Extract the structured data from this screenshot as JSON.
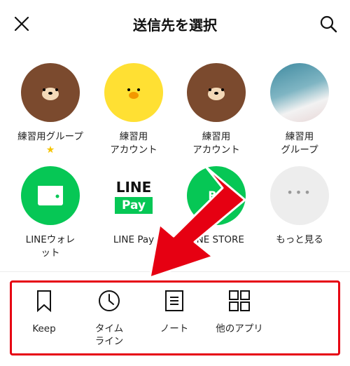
{
  "header": {
    "title": "送信先を選択"
  },
  "contacts": [
    {
      "line1": "練習用グループ",
      "line2": ""
    },
    {
      "line1": "練習用",
      "line2": "アカウント"
    },
    {
      "line1": "練習用",
      "line2": "アカウント"
    },
    {
      "line1": "練習用",
      "line2": "グループ"
    }
  ],
  "apps": [
    {
      "line1": "LINEウォレ",
      "line2": "ット"
    },
    {
      "line1": "LINE Pay",
      "line2": ""
    },
    {
      "line1": "LINE STORE",
      "line2": ""
    },
    {
      "line1": "もっと見る",
      "line2": ""
    }
  ],
  "linepay_logo": {
    "top": "LINE",
    "bottom": "Pay"
  },
  "store_badge": "RE",
  "more_dots": "•••",
  "tools": [
    {
      "line1": "Keep",
      "line2": ""
    },
    {
      "line1": "タイム",
      "line2": "ライン"
    },
    {
      "line1": "ノート",
      "line2": ""
    },
    {
      "line1": "他のアプリ",
      "line2": ""
    }
  ],
  "colors": {
    "line_green": "#06c755",
    "annotation_red": "#e60012",
    "bear_brown": "#7b4a2e",
    "chick_yellow": "#ffe033"
  }
}
